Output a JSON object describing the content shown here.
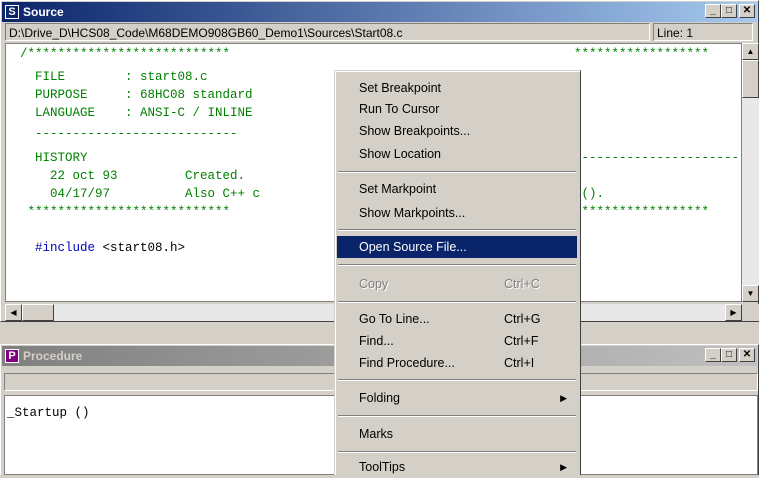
{
  "source_window": {
    "title": "Source",
    "icon_letter": "S",
    "path": "D:\\Drive_D\\HCS08_Code\\M68DEMO908GB60_Demo1\\Sources\\Start08.c",
    "line_label": "Line: 1",
    "caption_buttons": {
      "minimize": "_",
      "maximize": "□",
      "close": "✕"
    }
  },
  "code_lines": [
    {
      "text": "/***************************",
      "class": "green"
    },
    {
      "text": "  FILE        : start08.c",
      "class": "green"
    },
    {
      "text": "  PURPOSE     : 68HC08 standard",
      "class": "green"
    },
    {
      "text": "  LANGUAGE    : ANSI-C / INLINE",
      "class": "green"
    },
    {
      "text": "  ---------------------------",
      "class": "green"
    },
    {
      "text": "  HISTORY",
      "class": "green"
    },
    {
      "text": "    22 oct 93         Created.",
      "class": "green"
    },
    {
      "text": "    04/17/97          Also C++ c",
      "class": "green"
    },
    {
      "text": " ***************************",
      "class": "green"
    },
    {
      "text": "",
      "class": "green"
    },
    {
      "text": "  #include <start08.h>",
      "class": "include"
    }
  ],
  "code_right": {
    "stars_top": "******************",
    "dashes": "------------------------",
    "tail": "c().",
    "stars_bottom": "******************"
  },
  "procedure_window": {
    "title": "Procedure",
    "icon_letter": "P",
    "item": "_Startup ()"
  },
  "context_menu": {
    "items": [
      {
        "label": "Set Breakpoint"
      },
      {
        "label": "Run To Cursor"
      },
      {
        "label": "Show Breakpoints..."
      },
      {
        "label": "Show Location"
      },
      {
        "label": "Set Markpoint"
      },
      {
        "label": "Show Markpoints..."
      },
      {
        "label": "Open Source File...",
        "selected": true
      },
      {
        "label": "Copy",
        "shortcut": "Ctrl+C",
        "disabled": true
      },
      {
        "label": "Go To Line...",
        "shortcut": "Ctrl+G"
      },
      {
        "label": "Find...",
        "shortcut": "Ctrl+F"
      },
      {
        "label": "Find Procedure...",
        "shortcut": "Ctrl+I"
      },
      {
        "label": "Folding",
        "submenu": true
      },
      {
        "label": "Marks"
      },
      {
        "label": "ToolTips",
        "submenu": true
      }
    ]
  },
  "colors": {
    "title_active": "#0a246a",
    "menu_highlight": "#0a246a",
    "comment": "#008000",
    "keyword": "#0000c0"
  }
}
